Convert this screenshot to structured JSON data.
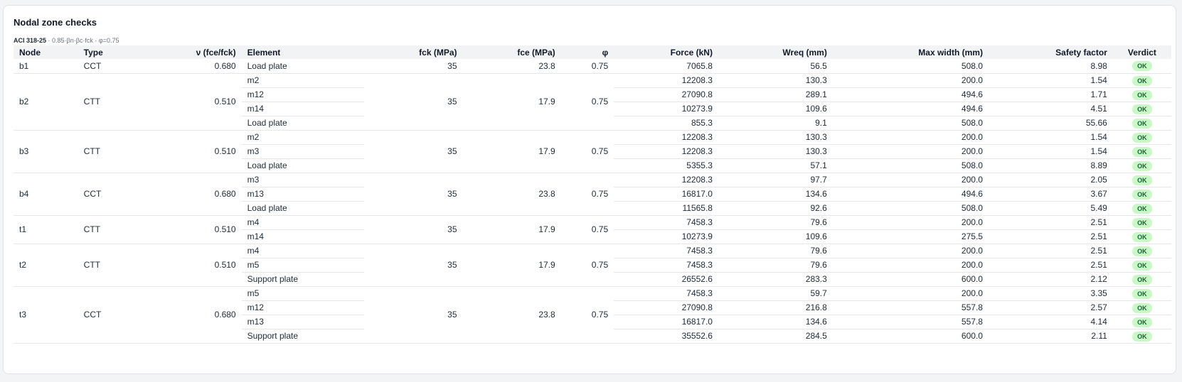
{
  "title": "Nodal zone checks",
  "subtitle": {
    "code": "ACI 318-25",
    "formula": "· 0.85·βn·βc·fck · φ=0.75"
  },
  "columns": [
    "Node",
    "Type",
    "ν (fce/fck)",
    "Element",
    "fck (MPa)",
    "fce (MPa)",
    "φ",
    "Force (kN)",
    "Wreq (mm)",
    "Max width (mm)",
    "Safety factor",
    "Verdict"
  ],
  "nodes": [
    {
      "node": "b1",
      "type": "CCT",
      "nu": "0.680",
      "fck": "35",
      "fce": "23.8",
      "phi": "0.75",
      "rows": [
        {
          "element": "Load plate",
          "force": "7065.8",
          "wreq": "56.5",
          "maxw": "508.0",
          "sf": "8.98",
          "verdict": "OK"
        }
      ]
    },
    {
      "node": "b2",
      "type": "CTT",
      "nu": "0.510",
      "fck": "35",
      "fce": "17.9",
      "phi": "0.75",
      "rows": [
        {
          "element": "m2",
          "force": "12208.3",
          "wreq": "130.3",
          "maxw": "200.0",
          "sf": "1.54",
          "verdict": "OK"
        },
        {
          "element": "m12",
          "force": "27090.8",
          "wreq": "289.1",
          "maxw": "494.6",
          "sf": "1.71",
          "verdict": "OK"
        },
        {
          "element": "m14",
          "force": "10273.9",
          "wreq": "109.6",
          "maxw": "494.6",
          "sf": "4.51",
          "verdict": "OK"
        },
        {
          "element": "Load plate",
          "force": "855.3",
          "wreq": "9.1",
          "maxw": "508.0",
          "sf": "55.66",
          "verdict": "OK"
        }
      ]
    },
    {
      "node": "b3",
      "type": "CTT",
      "nu": "0.510",
      "fck": "35",
      "fce": "17.9",
      "phi": "0.75",
      "rows": [
        {
          "element": "m2",
          "force": "12208.3",
          "wreq": "130.3",
          "maxw": "200.0",
          "sf": "1.54",
          "verdict": "OK"
        },
        {
          "element": "m3",
          "force": "12208.3",
          "wreq": "130.3",
          "maxw": "200.0",
          "sf": "1.54",
          "verdict": "OK"
        },
        {
          "element": "Load plate",
          "force": "5355.3",
          "wreq": "57.1",
          "maxw": "508.0",
          "sf": "8.89",
          "verdict": "OK"
        }
      ]
    },
    {
      "node": "b4",
      "type": "CCT",
      "nu": "0.680",
      "fck": "35",
      "fce": "23.8",
      "phi": "0.75",
      "rows": [
        {
          "element": "m3",
          "force": "12208.3",
          "wreq": "97.7",
          "maxw": "200.0",
          "sf": "2.05",
          "verdict": "OK"
        },
        {
          "element": "m13",
          "force": "16817.0",
          "wreq": "134.6",
          "maxw": "494.6",
          "sf": "3.67",
          "verdict": "OK"
        },
        {
          "element": "Load plate",
          "force": "11565.8",
          "wreq": "92.6",
          "maxw": "508.0",
          "sf": "5.49",
          "verdict": "OK"
        }
      ]
    },
    {
      "node": "t1",
      "type": "CTT",
      "nu": "0.510",
      "fck": "35",
      "fce": "17.9",
      "phi": "0.75",
      "rows": [
        {
          "element": "m4",
          "force": "7458.3",
          "wreq": "79.6",
          "maxw": "200.0",
          "sf": "2.51",
          "verdict": "OK"
        },
        {
          "element": "m14",
          "force": "10273.9",
          "wreq": "109.6",
          "maxw": "275.5",
          "sf": "2.51",
          "verdict": "OK"
        }
      ]
    },
    {
      "node": "t2",
      "type": "CTT",
      "nu": "0.510",
      "fck": "35",
      "fce": "17.9",
      "phi": "0.75",
      "rows": [
        {
          "element": "m4",
          "force": "7458.3",
          "wreq": "79.6",
          "maxw": "200.0",
          "sf": "2.51",
          "verdict": "OK"
        },
        {
          "element": "m5",
          "force": "7458.3",
          "wreq": "79.6",
          "maxw": "200.0",
          "sf": "2.51",
          "verdict": "OK"
        },
        {
          "element": "Support plate",
          "force": "26552.6",
          "wreq": "283.3",
          "maxw": "600.0",
          "sf": "2.12",
          "verdict": "OK"
        }
      ]
    },
    {
      "node": "t3",
      "type": "CCT",
      "nu": "0.680",
      "fck": "35",
      "fce": "23.8",
      "phi": "0.75",
      "rows": [
        {
          "element": "m5",
          "force": "7458.3",
          "wreq": "59.7",
          "maxw": "200.0",
          "sf": "3.35",
          "verdict": "OK"
        },
        {
          "element": "m12",
          "force": "27090.8",
          "wreq": "216.8",
          "maxw": "557.8",
          "sf": "2.57",
          "verdict": "OK"
        },
        {
          "element": "m13",
          "force": "16817.0",
          "wreq": "134.6",
          "maxw": "557.8",
          "sf": "4.14",
          "verdict": "OK"
        },
        {
          "element": "Support plate",
          "force": "35552.6",
          "wreq": "284.5",
          "maxw": "600.0",
          "sf": "2.11",
          "verdict": "OK"
        }
      ]
    }
  ],
  "colors": {
    "ok_bg": "#c9f7c7",
    "ok_text": "#166534",
    "header_bg": "#f1f3f5"
  }
}
